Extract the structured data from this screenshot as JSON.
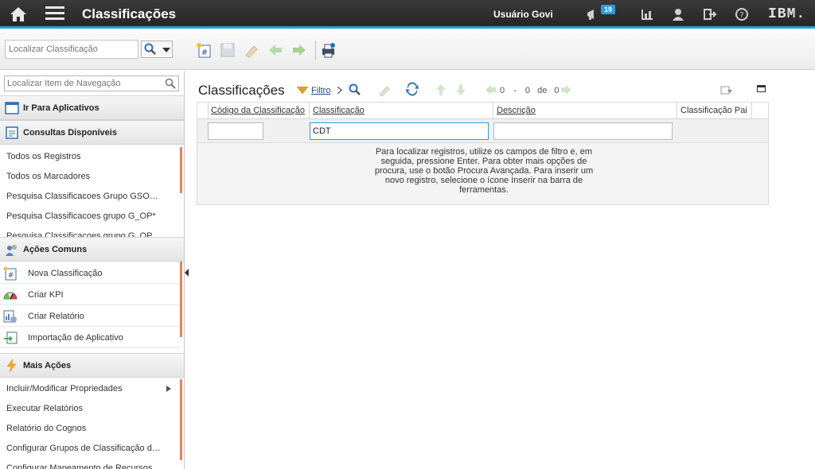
{
  "topbar": {
    "app_title": "Classificações",
    "user_name": "Usuário Govi",
    "notifications_count": "19",
    "brand": "IBM."
  },
  "toolbar": {
    "search_placeholder": "Localizar Classificação"
  },
  "nav": {
    "search_placeholder": "Localizar Item de Navegação",
    "goto_apps": "Ir Para Aplicativos",
    "available_queries": "Consultas Disponíveis",
    "queries": [
      "Todos os Registros",
      "Todos os Marcadores",
      "Pesquisa Classificacoes Grupo GSO…",
      "Pesquisa Classificacoes grupo G_OP*",
      "Pesquisa Classificacoes grupo G_OP…"
    ],
    "common_actions": "Ações Comuns",
    "actions": [
      "Nova Classificação",
      "Criar KPI",
      "Criar Relatório",
      "Importação de Aplicativo"
    ],
    "more_actions": "Mais Ações",
    "more": [
      "Incluir/Modificar Propriedades",
      "Executar Relatórios",
      "Relatório do Cognos",
      "Configurar Grupos de Classificação d…",
      "Configurar Mapeamento de Recursos…"
    ]
  },
  "main": {
    "title": "Classificações",
    "filter_label": "Filtro",
    "pager": {
      "start": "0",
      "dash": "-",
      "end": "0",
      "of": "de",
      "total": "0"
    },
    "columns": [
      "Código da Classificação",
      "Classificação",
      "Descrição",
      "Classificação Pai"
    ],
    "filters": {
      "code": "",
      "classification": "CDT",
      "description": ""
    },
    "hint": "Para localizar registros, utilize os campos de filtro e, em seguida, pressione Enter. Para obter mais opções de procura, use o botão Procura Avançada. Para inserir um novo registro, selecione o ícone Inserir na barra de ferramentas."
  },
  "colors": {
    "accent": "#2d9cd8",
    "scroll_mark": "#e8825a",
    "topbar": "#2b2b2b"
  }
}
